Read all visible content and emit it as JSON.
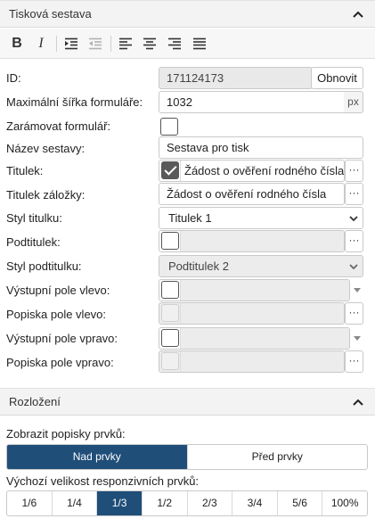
{
  "panel": {
    "title": "Tisková sestava"
  },
  "toolbar": {
    "bold": "B",
    "italic": "I"
  },
  "form": {
    "id": {
      "label": "ID:",
      "value": "171124173",
      "button": "Obnovit"
    },
    "max_width": {
      "label": "Maximální šířka formuláře:",
      "value": "1032",
      "unit": "px"
    },
    "frame": {
      "label": "Zarámovat formulář:"
    },
    "report_name": {
      "label": "Název sestavy:",
      "value": "Sestava pro tisk"
    },
    "title": {
      "label": "Titulek:",
      "value": "Žádost o ověření rodného čísla",
      "dots": "···"
    },
    "tab_title": {
      "label": "Titulek záložky:",
      "value": "Žádost o ověření rodného čísla",
      "dots": "···"
    },
    "title_style": {
      "label": "Styl titulku:",
      "value": "Titulek 1"
    },
    "subtitle": {
      "label": "Podtitulek:",
      "dots": "···"
    },
    "subtitle_style": {
      "label": "Styl podtitulku:",
      "value": "Podtitulek 2"
    },
    "out_left": {
      "label": "Výstupní pole vlevo:"
    },
    "caption_left": {
      "label": "Popiska pole vlevo:",
      "dots": "···"
    },
    "out_right": {
      "label": "Výstupní pole vpravo:"
    },
    "caption_right": {
      "label": "Popiska pole vpravo:",
      "dots": "···"
    }
  },
  "layout": {
    "title": "Rozložení",
    "show_labels": {
      "label": "Zobrazit popisky prvků:",
      "options": [
        "Nad prvky",
        "Před prvky"
      ],
      "selected": "Nad prvky"
    },
    "default_size": {
      "label": "Výchozí velikost responzivních prvků:",
      "options": [
        "1/6",
        "1/4",
        "1/3",
        "1/2",
        "2/3",
        "3/4",
        "5/6",
        "100%"
      ],
      "selected": "1/3"
    }
  },
  "colors": {
    "accent": "#1f4e79",
    "header_bg": "#f3f3f3"
  }
}
